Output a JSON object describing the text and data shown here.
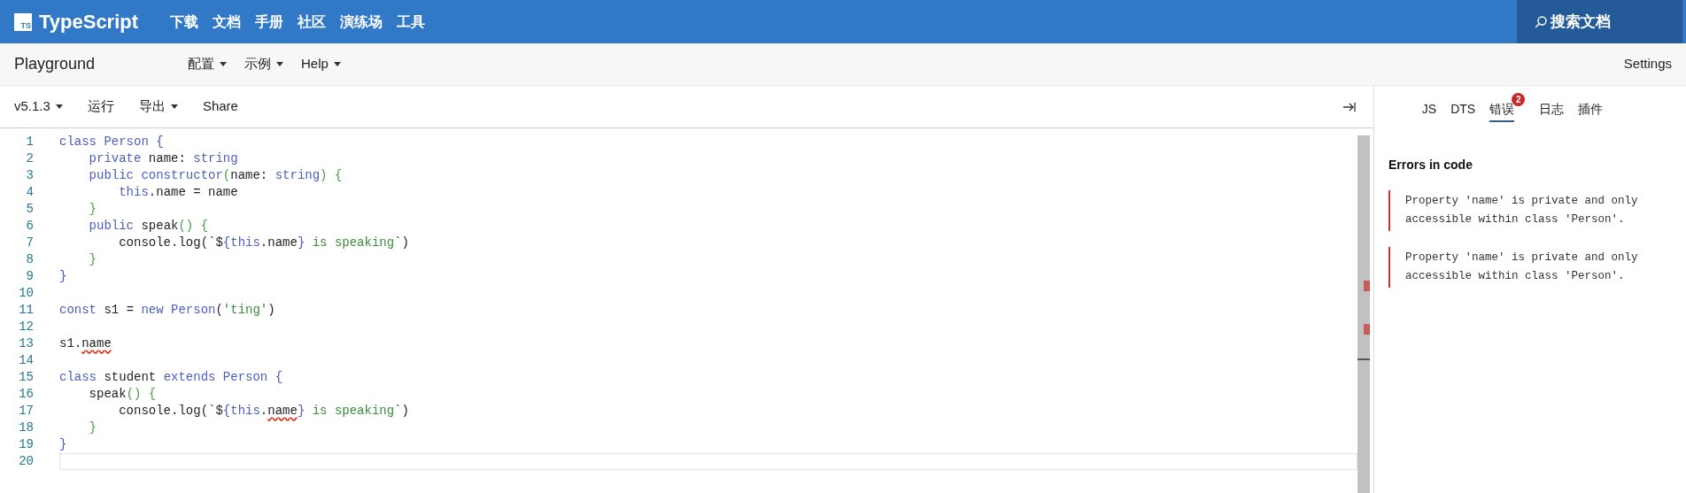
{
  "header": {
    "logo_mark": "TS",
    "brand": "TypeScript",
    "nav": [
      "下载",
      "文档",
      "手册",
      "社区",
      "演练场",
      "工具"
    ],
    "search": "搜索文档"
  },
  "subheader": {
    "title": "Playground",
    "menus": [
      {
        "label": "配置",
        "dropdown": true
      },
      {
        "label": "示例",
        "dropdown": true
      },
      {
        "label": "Help",
        "dropdown": true
      }
    ],
    "settings": "Settings"
  },
  "toolbar": [
    {
      "label": "v5.1.3",
      "dropdown": true
    },
    {
      "label": "运行",
      "dropdown": false
    },
    {
      "label": "导出",
      "dropdown": true
    },
    {
      "label": "Share",
      "dropdown": false
    }
  ],
  "editor": {
    "lines": [
      {
        "number": "1",
        "current": false,
        "tokens": [
          {
            "kind": "keyword",
            "text": "class Person "
          },
          {
            "kind": "bracket1",
            "text": "{"
          }
        ]
      },
      {
        "number": "2",
        "current": false,
        "tokens": [
          {
            "kind": "keyword",
            "text": "    private "
          },
          {
            "kind": "plain",
            "text": "name: "
          },
          {
            "kind": "keyword",
            "text": "string"
          }
        ]
      },
      {
        "number": "3",
        "current": false,
        "tokens": [
          {
            "kind": "keyword",
            "text": "    public constructor"
          },
          {
            "kind": "bracket2",
            "text": "("
          },
          {
            "kind": "plain",
            "text": "name: "
          },
          {
            "kind": "keyword",
            "text": "string"
          },
          {
            "kind": "bracket2",
            "text": ") {"
          }
        ]
      },
      {
        "number": "4",
        "current": false,
        "tokens": [
          {
            "kind": "keyword",
            "text": "        this"
          },
          {
            "kind": "plain",
            "text": ".name = name"
          }
        ]
      },
      {
        "number": "5",
        "current": false,
        "tokens": [
          {
            "kind": "bracket2",
            "text": "    }"
          }
        ]
      },
      {
        "number": "6",
        "current": false,
        "tokens": [
          {
            "kind": "keyword",
            "text": "    public "
          },
          {
            "kind": "plain",
            "text": "speak"
          },
          {
            "kind": "bracket2",
            "text": "() {"
          }
        ]
      },
      {
        "number": "7",
        "current": false,
        "tokens": [
          {
            "kind": "plain",
            "text": "        console.log(`$"
          },
          {
            "kind": "bracket1",
            "text": "{"
          },
          {
            "kind": "keyword",
            "text": "this"
          },
          {
            "kind": "plain",
            "text": ".name"
          },
          {
            "kind": "bracket1",
            "text": "}"
          },
          {
            "kind": "string",
            "text": " is speaking"
          },
          {
            "kind": "plain",
            "text": "`)"
          }
        ]
      },
      {
        "number": "8",
        "current": false,
        "tokens": [
          {
            "kind": "bracket2",
            "text": "    }"
          }
        ]
      },
      {
        "number": "9",
        "current": false,
        "tokens": [
          {
            "kind": "bracket1",
            "text": "}"
          }
        ]
      },
      {
        "number": "10",
        "current": false
      },
      {
        "number": "11",
        "current": false,
        "tokens": [
          {
            "kind": "keyword",
            "text": "const "
          },
          {
            "kind": "plain",
            "text": "s1 = "
          },
          {
            "kind": "keyword",
            "text": "new Person"
          },
          {
            "kind": "plain",
            "text": "("
          },
          {
            "kind": "string",
            "text": "'ting'"
          },
          {
            "kind": "plain",
            "text": ")"
          }
        ]
      },
      {
        "number": "12",
        "current": false
      },
      {
        "number": "13",
        "current": false,
        "tokens": [
          {
            "kind": "plain",
            "text": "s1."
          },
          {
            "kind": "error",
            "text": "name"
          }
        ]
      },
      {
        "number": "14",
        "current": false
      },
      {
        "number": "15",
        "current": false,
        "tokens": [
          {
            "kind": "keyword",
            "text": "class "
          },
          {
            "kind": "plain",
            "text": "student "
          },
          {
            "kind": "keyword",
            "text": "extends Person "
          },
          {
            "kind": "bracket1",
            "text": "{"
          }
        ]
      },
      {
        "number": "16",
        "current": false,
        "tokens": [
          {
            "kind": "plain",
            "text": "    speak"
          },
          {
            "kind": "bracket2",
            "text": "() {"
          }
        ]
      },
      {
        "number": "17",
        "current": false,
        "tokens": [
          {
            "kind": "plain",
            "text": "        console.log(`$"
          },
          {
            "kind": "bracket1",
            "text": "{"
          },
          {
            "kind": "keyword",
            "text": "this"
          },
          {
            "kind": "plain",
            "text": "."
          },
          {
            "kind": "error",
            "text": "name"
          },
          {
            "kind": "bracket1",
            "text": "}"
          },
          {
            "kind": "string",
            "text": " is speaking"
          },
          {
            "kind": "plain",
            "text": "`)"
          }
        ]
      },
      {
        "number": "18",
        "current": false,
        "tokens": [
          {
            "kind": "bracket2",
            "text": "    }"
          }
        ]
      },
      {
        "number": "19",
        "current": false,
        "tokens": [
          {
            "kind": "bracket1",
            "text": "}"
          }
        ]
      },
      {
        "number": "20",
        "current": true
      }
    ]
  },
  "sidebar": {
    "tabs": [
      {
        "label": "JS",
        "selected": false
      },
      {
        "label": "DTS",
        "selected": false
      },
      {
        "label": "错误",
        "selected": true,
        "badge": "2"
      },
      {
        "label": "日志",
        "selected": false
      },
      {
        "label": "插件",
        "selected": false
      }
    ],
    "heading": "Errors in code",
    "errors": [
      "Property 'name' is private and only accessible within class 'Person'.",
      "Property 'name' is private and only accessible within class 'Person'."
    ]
  }
}
